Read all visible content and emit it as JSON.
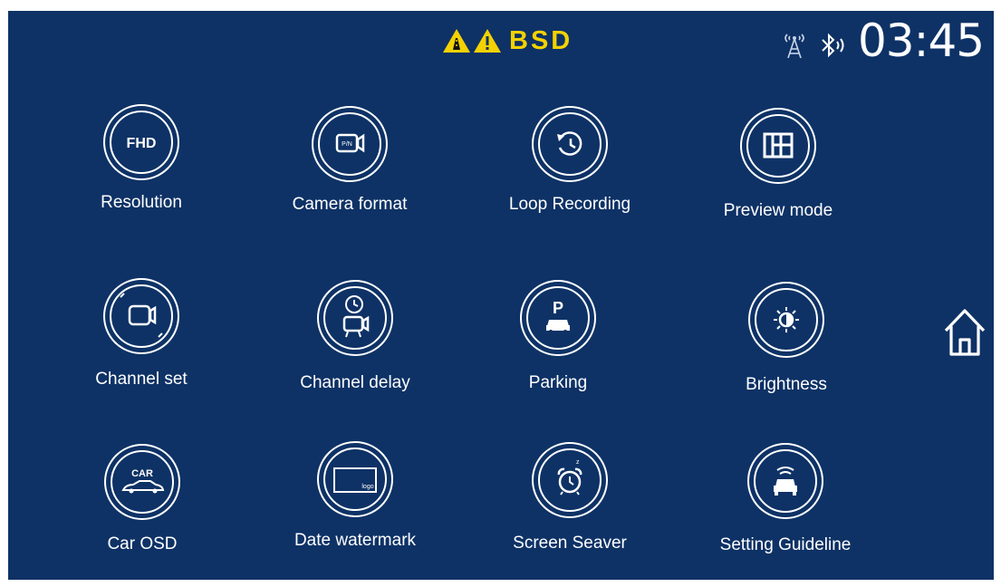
{
  "status_bar": {
    "warning_icons": [
      "road-hazard-warning-icon",
      "warning-triangle-icon"
    ],
    "bsd_label": "BSD",
    "signal_icon": "antenna-signal-icon",
    "bluetooth_icon": "bluetooth-icon",
    "time": "03:45",
    "accent_yellow": "#f3d200",
    "background": "#0e3266"
  },
  "menu": {
    "items": [
      {
        "label": "Resolution",
        "icon": "fhd-icon",
        "icon_text": "FHD"
      },
      {
        "label": "Camera format",
        "icon": "camera-format-icon",
        "icon_text": "P/N"
      },
      {
        "label": "Loop Recording",
        "icon": "loop-recording-icon"
      },
      {
        "label": "Preview mode",
        "icon": "preview-layout-icon"
      },
      {
        "label": "Channel set",
        "icon": "channel-camera-icon"
      },
      {
        "label": "Channel delay",
        "icon": "clock-camera-icon"
      },
      {
        "label": "Parking",
        "icon": "parking-icon",
        "icon_text": "P"
      },
      {
        "label": "Brightness",
        "icon": "brightness-icon"
      },
      {
        "label": "Car OSD",
        "icon": "car-osd-icon",
        "icon_text": "CAR"
      },
      {
        "label": "Date watermark",
        "icon": "watermark-logo-icon",
        "icon_text": "logo"
      },
      {
        "label": "Screen Seaver",
        "icon": "alarm-clock-icon"
      },
      {
        "label": "Setting Guideline",
        "icon": "car-guideline-icon"
      }
    ]
  },
  "home_icon": "home-icon"
}
